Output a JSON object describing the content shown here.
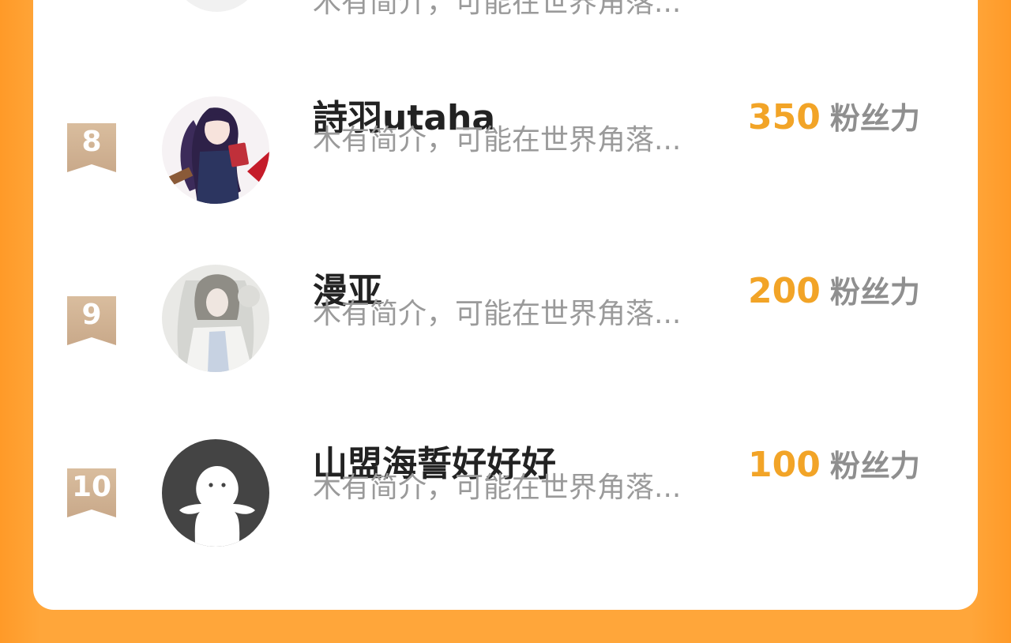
{
  "top_partial": {
    "desc": "木有简介，可能在世界角落..."
  },
  "rows": [
    {
      "rank": "8",
      "name": "詩羽utaha",
      "desc": "木有简介，可能在世界角落...",
      "score": "350",
      "unit": "粉丝力",
      "avatar": "anime-girl-avatar"
    },
    {
      "rank": "9",
      "name": "漫亚",
      "desc": "木有简介，可能在世界角落...",
      "score": "200",
      "unit": "粉丝力",
      "avatar": "anime-character-avatar"
    },
    {
      "rank": "10",
      "name": "山盟海誓好好好",
      "desc": "木有简介，可能在世界角落...",
      "score": "100",
      "unit": "粉丝力",
      "avatar": "default-user-avatar"
    }
  ],
  "colors": {
    "background": "#ffa63a",
    "card": "#ffffff",
    "score": "#f2a427",
    "rank_badge": "#d2b497",
    "name": "#222222",
    "desc": "#9a9a9a"
  }
}
